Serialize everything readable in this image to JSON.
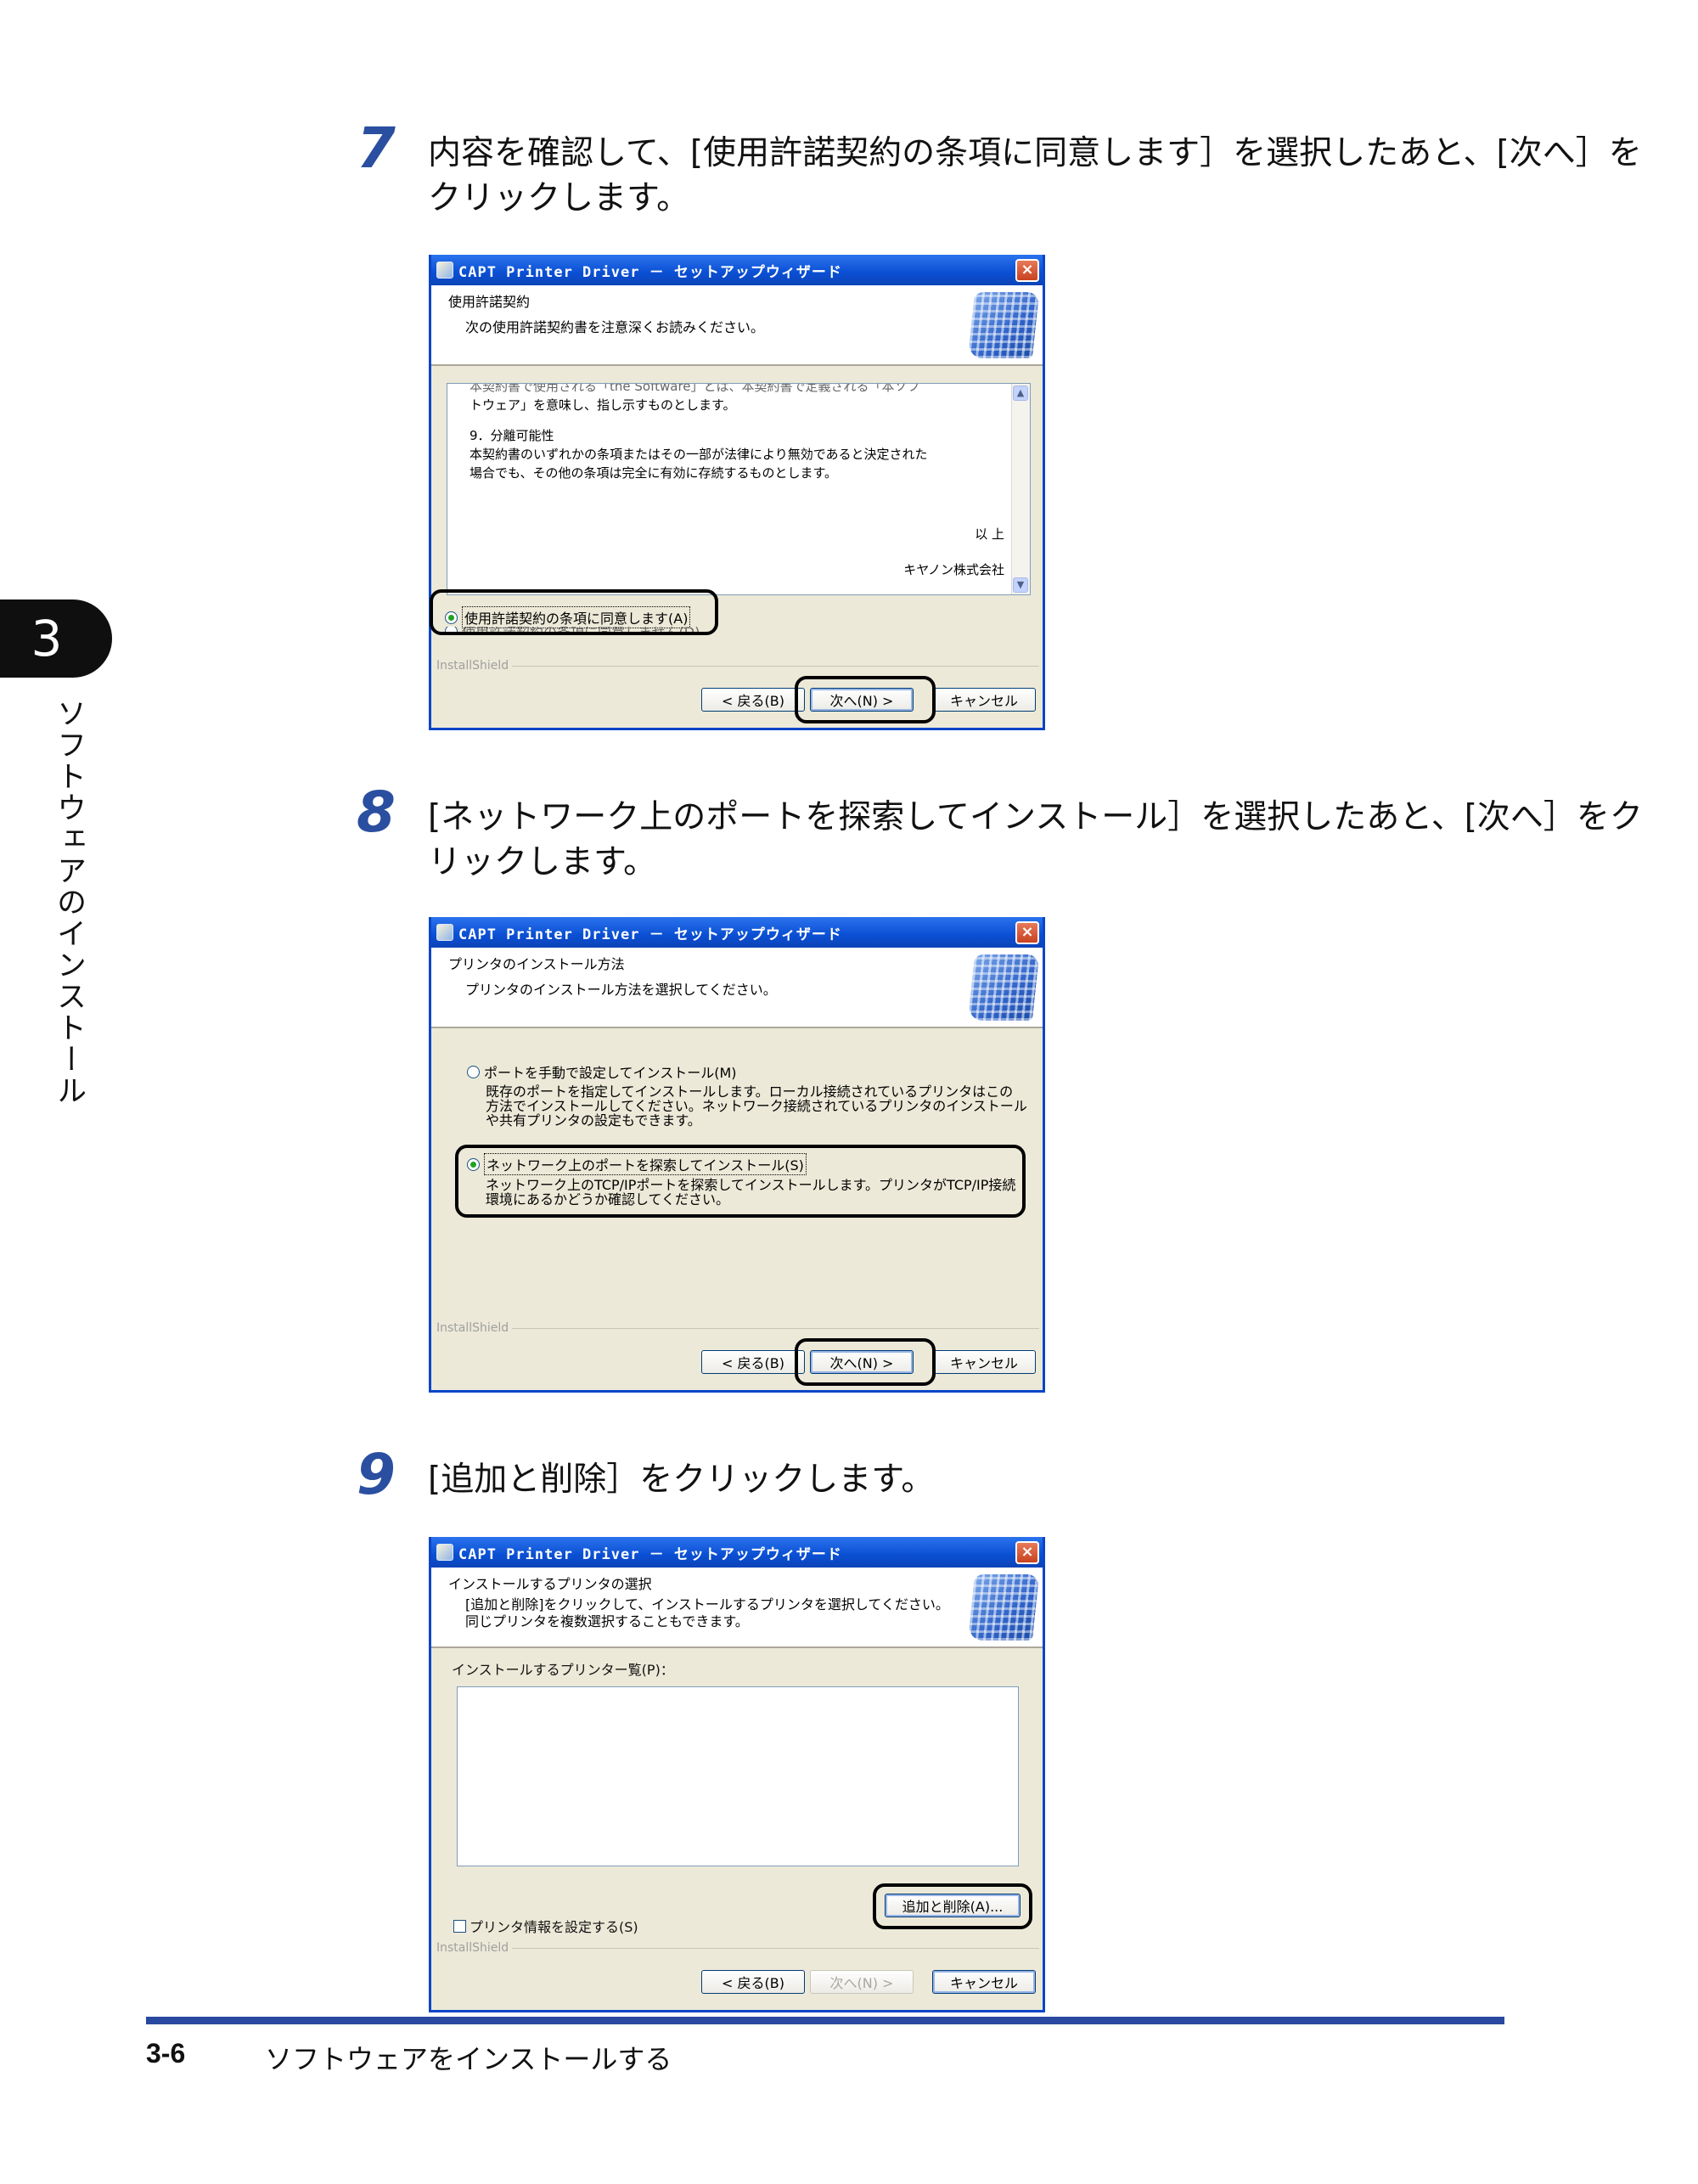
{
  "chapter": {
    "number": "3",
    "side_label": "ソフトウェアのインストール"
  },
  "steps": [
    {
      "number": "7",
      "text": "内容を確認して、[使用許諾契約の条項に同意します］を選択したあと、[次へ］をクリックします。"
    },
    {
      "number": "8",
      "text": "[ネットワーク上のポートを探索してインストール］を選択したあと、[次へ］をクリックします。"
    },
    {
      "number": "9",
      "text": "[追加と削除］をクリックします。"
    }
  ],
  "dialog_common": {
    "title": "CAPT Printer Driver － セットアップウィザード",
    "close_icon": "×",
    "installshield": "InstallShield",
    "back_button": "< 戻る(B)",
    "next_button": "次へ(N) >",
    "cancel_button": "キャンセル"
  },
  "dialog1": {
    "header_title": "使用許諾契約",
    "header_sub": "次の使用許諾契約書を注意深くお読みください。",
    "license_lines": [
      "本契約書で使用される「the Software」とは、本契約書で定義される「本ソフ",
      "トウェア」を意味し、指し示すものとします。",
      "9．分離可能性",
      "本契約書のいずれかの条項またはその一部が法律により無効であると決定された",
      "場合でも、その他の条項は完全に有効に存続するものとします。",
      "以 上",
      "キヤノン株式会社"
    ],
    "radio_accept": "使用許諾契約の条項に同意します(A)",
    "radio_decline": "使用許諾契約の条項に同意しません(D)"
  },
  "dialog2": {
    "header_title": "プリンタのインストール方法",
    "header_sub": "プリンタのインストール方法を選択してください。",
    "option_manual_label": "ポートを手動で設定してインストール(M)",
    "option_manual_desc": [
      "既存のポートを指定してインストールします。ローカル接続されているプリンタはこの",
      "方法でインストールしてください。ネットワーク接続されているプリンタのインストール",
      "や共有プリンタの設定もできます。"
    ],
    "option_network_label": "ネットワーク上のポートを探索してインストール(S)",
    "option_network_desc": [
      "ネットワーク上のTCP/IPポートを探索してインストールします。プリンタがTCP/IP接続",
      "環境にあるかどうか確認してください。"
    ]
  },
  "dialog3": {
    "header_title": "インストールするプリンタの選択",
    "header_sub": [
      "[追加と削除]をクリックして、インストールするプリンタを選択してください。",
      "同じプリンタを複数選択することもできます。"
    ],
    "list_label": "インストールするプリンター覧(P)：",
    "add_remove_button": "追加と削除(A)...",
    "checkbox_label": "プリンタ情報を設定する(S)"
  },
  "footer": {
    "page": "3-6",
    "title": "ソフトウェアをインストールする"
  }
}
